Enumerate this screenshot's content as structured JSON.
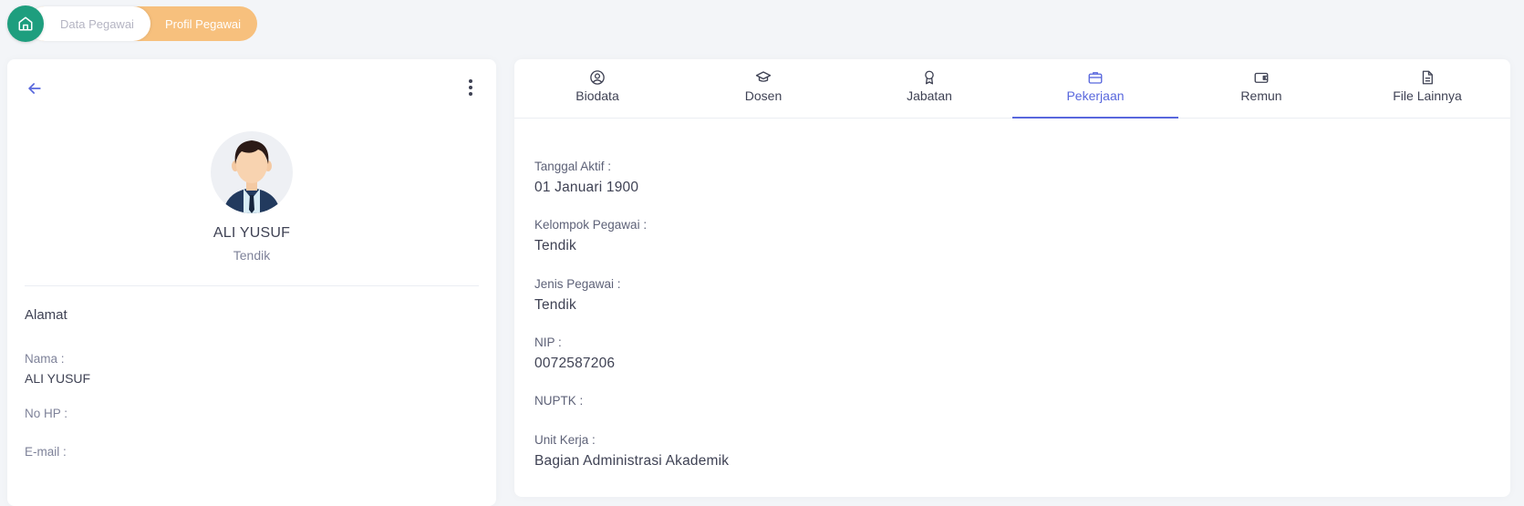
{
  "breadcrumb": {
    "items": [
      "Data Pegawai",
      "Profil Pegawai"
    ]
  },
  "colors": {
    "home": "#1e9e7e",
    "breadcrumb_active": "#f7c07d",
    "tab_active": "#5867dd"
  },
  "profile": {
    "name": "ALI YUSUF",
    "role": "Tendik",
    "section_title": "Alamat",
    "fields": [
      {
        "label": "Nama :",
        "value": "ALI YUSUF"
      },
      {
        "label": "No HP :",
        "value": ""
      },
      {
        "label": "E-mail :",
        "value": ""
      }
    ]
  },
  "tabs": [
    {
      "label": "Biodata",
      "icon": "user-circle-icon"
    },
    {
      "label": "Dosen",
      "icon": "graduation-cap-icon"
    },
    {
      "label": "Jabatan",
      "icon": "award-icon"
    },
    {
      "label": "Pekerjaan",
      "icon": "briefcase-icon",
      "active": true
    },
    {
      "label": "Remun",
      "icon": "wallet-icon"
    },
    {
      "label": "File Lainnya",
      "icon": "file-icon"
    }
  ],
  "pekerjaan": {
    "fields": [
      {
        "label": "Tanggal Aktif :",
        "value": "01 Januari 1900"
      },
      {
        "label": "Kelompok Pegawai :",
        "value": "Tendik"
      },
      {
        "label": "Jenis Pegawai :",
        "value": "Tendik"
      },
      {
        "label": "NIP :",
        "value": "0072587206"
      },
      {
        "label": "NUPTK :",
        "value": ""
      },
      {
        "label": "Unit Kerja :",
        "value": "Bagian Administrasi Akademik"
      }
    ]
  }
}
